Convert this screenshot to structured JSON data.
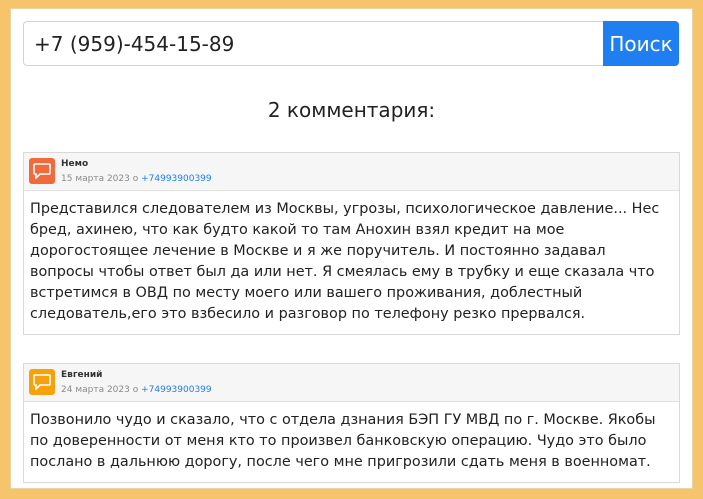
{
  "search": {
    "value": "+7 (959)-454-15-89",
    "button_label": "Поиск"
  },
  "comments_title": "2 комментария:",
  "comments": [
    {
      "author": "Немо",
      "date": "15 марта 2023 о",
      "phone": "+74993900399",
      "avatar_color": "#f06a3b",
      "text": "Представился следователем из Москвы, угрозы, психологическое давление... Нес бред, ахинею, что как будто какой то там Анохин взял кредит на мое дорогостоящее лечение в Москве и я же поручитель. И постоянно задавал вопросы чтобы ответ был да или нет. Я смеялась ему в трубку и еще сказала что встретимся в ОВД по месту моего или вашего проживания, доблестный следователь,его это взбесило и разговор по телефону резко прервался."
    },
    {
      "author": "Евгений",
      "date": "24 марта 2023 о",
      "phone": "+74993900399",
      "avatar_color": "#f5a20b",
      "text": "Позвонило чудо и сказало, что с отдела дзнания БЭП ГУ МВД по г. Москве. Якобы по доверенности от меня кто то произвел банковскую операцию. Чудо это было послано в дальнюю дорогу, после чего мне пригрозили сдать меня в военномат."
    }
  ],
  "colors": {
    "frame": "#f6c56b",
    "accent": "#1f7ef0"
  },
  "icons": {
    "avatar": "speech-bubble-icon"
  }
}
